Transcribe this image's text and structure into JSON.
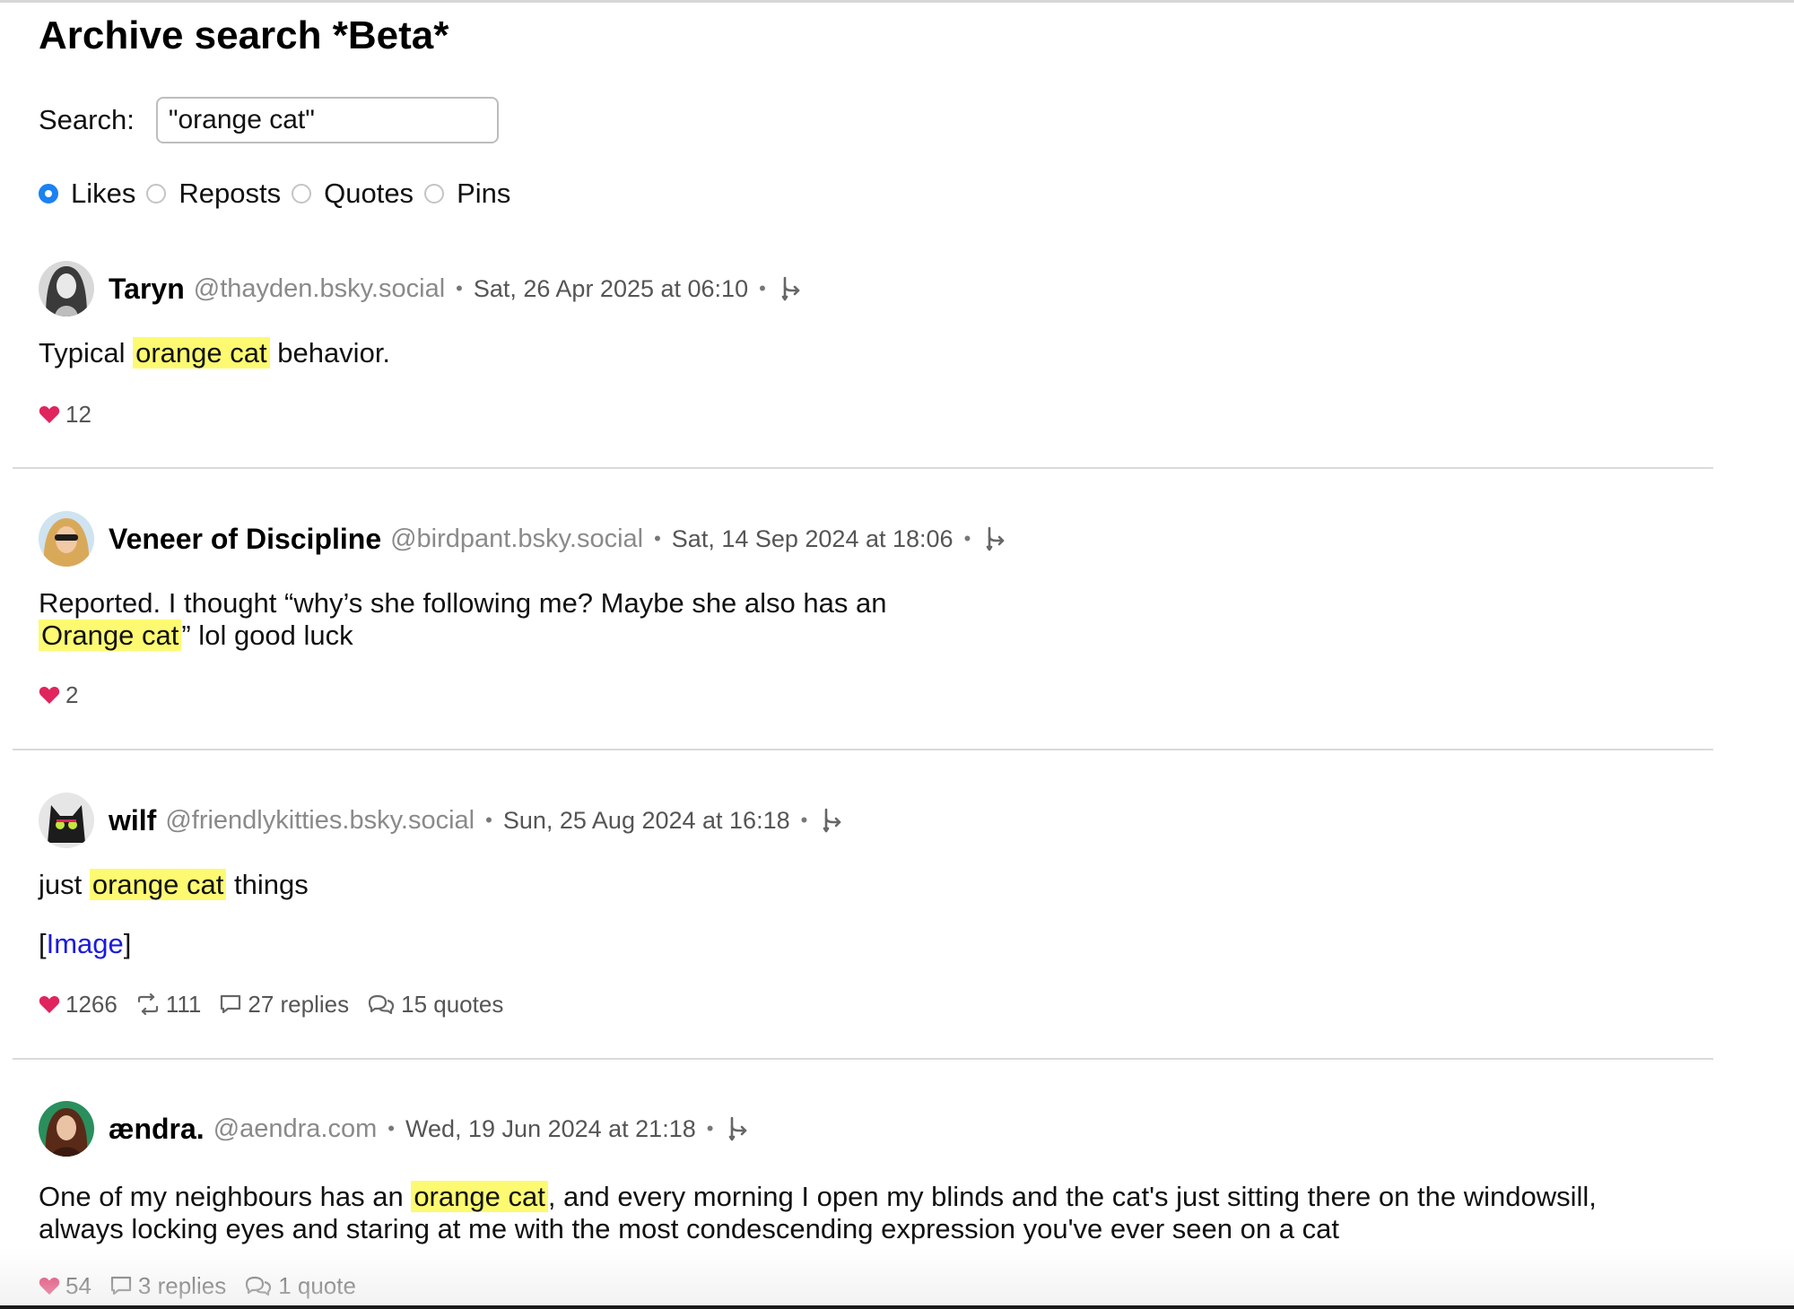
{
  "page": {
    "title": "Archive search *Beta*"
  },
  "search": {
    "label": "Search:",
    "value": "\"orange cat\"",
    "placeholder": ""
  },
  "filters": [
    {
      "label": "Likes",
      "checked": true
    },
    {
      "label": "Reposts",
      "checked": false
    },
    {
      "label": "Quotes",
      "checked": false
    },
    {
      "label": "Pins",
      "checked": false
    }
  ],
  "separator": "•",
  "colors": {
    "highlight": "#fdfa72",
    "heart": "#e0245e",
    "link": "#1a1adf",
    "radio_accent": "#1a82f2"
  },
  "posts": [
    {
      "author": "Taryn",
      "handle": "@thayden.bsky.social",
      "date": "Sat, 26 Apr 2025 at 06:10",
      "text": {
        "before": "Typical ",
        "highlight": "orange cat",
        "after": " behavior."
      },
      "likes": "12"
    },
    {
      "author": "Veneer of Discipline",
      "handle": "@birdpant.bsky.social",
      "date": "Sat, 14 Sep 2024 at 18:06",
      "text": {
        "line1": "Reported. I thought “why’s she following me? Maybe she also has an",
        "highlight": "Orange cat",
        "after": "” lol good luck"
      },
      "likes": "2"
    },
    {
      "author": "wilf",
      "handle": "@friendlykitties.bsky.social",
      "date": "Sun, 25 Aug 2024 at 16:18",
      "text": {
        "before": "just ",
        "highlight": "orange cat",
        "after": " things"
      },
      "image_link": {
        "open": "[",
        "label": "Image",
        "close": "]"
      },
      "likes": "1266",
      "reposts": "111",
      "replies": "27 replies",
      "quotes": "15 quotes"
    },
    {
      "author": "ændra.",
      "handle": "@aendra.com",
      "date": "Wed, 19 Jun 2024 at 21:18",
      "text": {
        "before": "One of my neighbours has an ",
        "highlight": "orange cat",
        "after": ", and every morning I open my blinds and the cat's just sitting there on the windowsill,",
        "line2": "always locking eyes and staring at me with the most condescending expression you've ever seen on a cat"
      },
      "likes": "54",
      "replies": "3 replies",
      "quotes": "1 quote"
    }
  ]
}
